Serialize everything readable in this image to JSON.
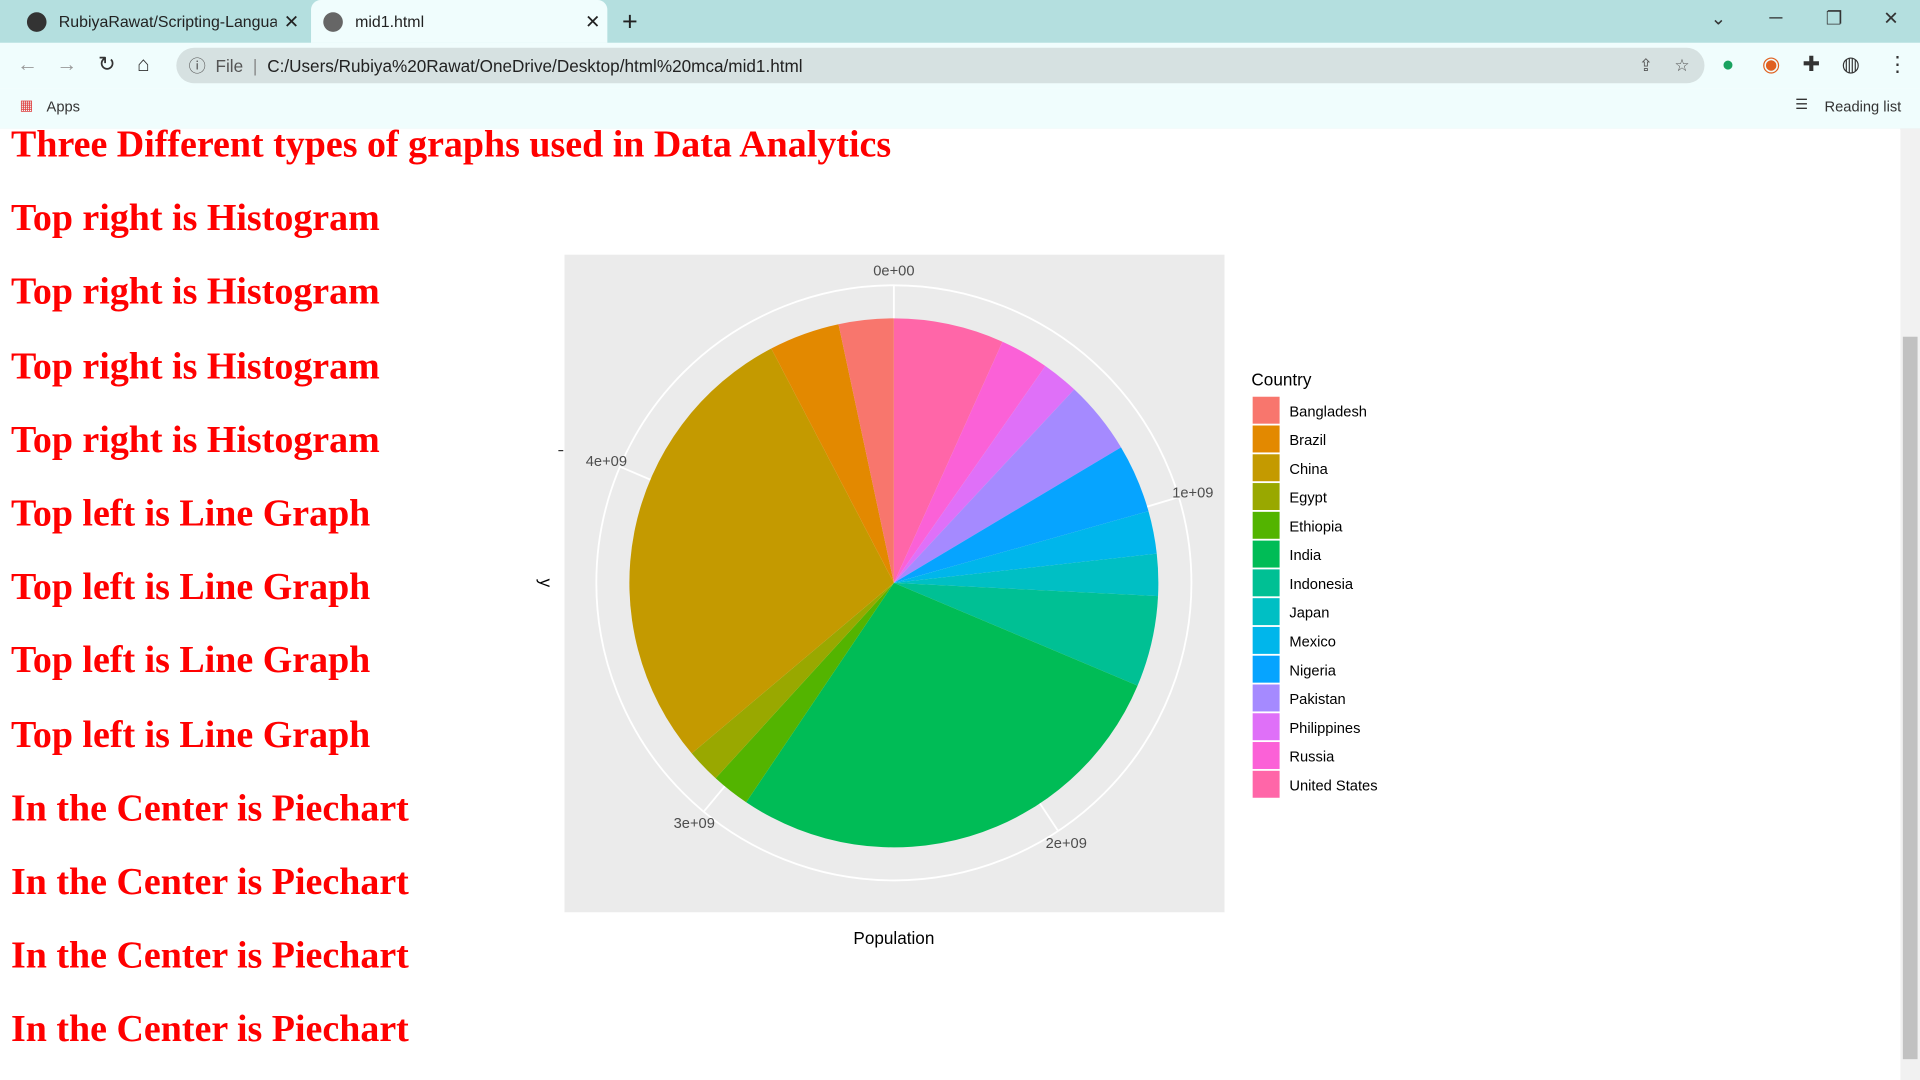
{
  "browser": {
    "tabs": [
      {
        "label": "RubiyaRawat/Scripting-Languages",
        "icon": "github-icon"
      },
      {
        "label": "mid1.html",
        "icon": "globe-icon"
      }
    ],
    "address": {
      "scheme_label": "File",
      "url": "C:/Users/Rubiya%20Rawat/OneDrive/Desktop/html%20mca/mid1.html"
    },
    "bookmarks": {
      "apps_label": "Apps",
      "reading_list_label": "Reading list"
    }
  },
  "page": {
    "headings": [
      "Three Different types of graphs used in Data Analytics",
      "Top right is Histogram",
      "Top right is Histogram",
      "Top right is Histogram",
      "Top right is Histogram",
      "Top left is Line Graph",
      "Top left is Line Graph",
      "Top left is Line Graph",
      "Top left is Line Graph",
      "In the Center is Piechart",
      "In the Center is Piechart",
      "In the Center is Piechart",
      "In the Center is Piechart"
    ]
  },
  "chart_data": {
    "type": "pie",
    "xlabel": "Population",
    "ylabel": "y",
    "legend_title": "Country",
    "legend_position": "right",
    "axis_ticks": [
      "0e+00",
      "1e+09",
      "2e+09",
      "3e+09",
      "4e+09"
    ],
    "axis_tick_values": [
      0,
      1000000000,
      2000000000,
      3000000000,
      4000000000
    ],
    "categories": [
      "Bangladesh",
      "Brazil",
      "China",
      "Egypt",
      "Ethiopia",
      "India",
      "Indonesia",
      "Japan",
      "Mexico",
      "Nigeria",
      "Pakistan",
      "Philippines",
      "Russia",
      "United States"
    ],
    "values": [
      165000000,
      212000000,
      1400000000,
      102000000,
      115000000,
      1380000000,
      273000000,
      126000000,
      128000000,
      206000000,
      221000000,
      110000000,
      146000000,
      331000000
    ],
    "colors": [
      "#F8766D",
      "#E38900",
      "#C49A00",
      "#99A800",
      "#53B400",
      "#00BC56",
      "#00C094",
      "#00BFC4",
      "#00B6EB",
      "#06A4FF",
      "#A58AFF",
      "#DF70F8",
      "#FB61D7",
      "#FF66A8"
    ]
  }
}
